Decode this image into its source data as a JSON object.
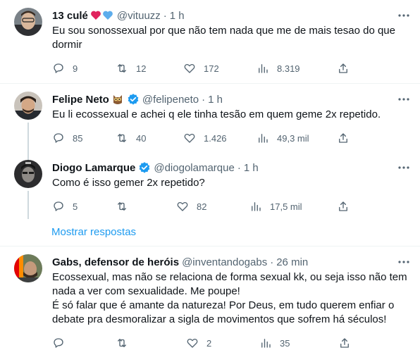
{
  "tweets": [
    {
      "name": "13 culé",
      "emoji": "❤️💙",
      "handle": "@vituuzz",
      "time": "1 h",
      "text": "Eu sou sonossexual por que não tem nada que me de mais tesao do que dormir",
      "replies": "9",
      "retweets": "12",
      "likes": "172",
      "views": "8.319",
      "verified": false
    },
    {
      "name": "Felipe Neto",
      "emoji": "🦉",
      "handle": "@felipeneto",
      "time": "1 h",
      "text": "Eu li ecossexual e achei q ele tinha tesão em quem geme 2x repetido.",
      "replies": "85",
      "retweets": "40",
      "likes": "1.426",
      "views": "49,3 mil",
      "verified": true
    },
    {
      "name": "Diogo Lamarque",
      "emoji": "",
      "handle": "@diogolamarque",
      "time": "1 h",
      "text": "Como é isso gemer 2x repetido?",
      "replies": "5",
      "retweets": "",
      "likes": "82",
      "views": "17,5 mil",
      "verified": true
    },
    {
      "name": "Gabs, defensor de heróis",
      "emoji": "",
      "handle": "@inventandogabs",
      "time": "26 min",
      "text": "Ecossexual, mas não se relaciona de forma sexual kk, ou seja isso não tem\nnada a ver com sexualidade. Me poupe!\nÉ só falar que é amante da natureza! Por Deus, em tudo querem enfiar o\ndebate pra desmoralizar a sigla de movimentos que sofrem há séculos!",
      "replies": "",
      "retweets": "",
      "likes": "2",
      "views": "35",
      "verified": false
    }
  ],
  "show_replies_label": "Mostrar respostas",
  "dot": "·",
  "colors": {
    "accent": "#1d9bf0",
    "secondary_text": "#536471",
    "primary_text": "#0f1419",
    "divider": "#eff3f4"
  }
}
